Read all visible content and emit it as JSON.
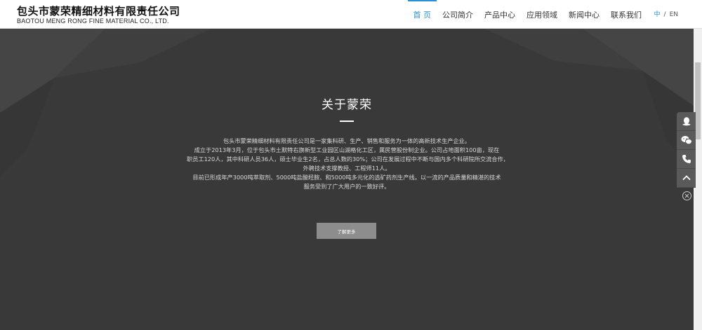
{
  "header": {
    "logo_cn": "包头市蒙荣精细材料有限责任公司",
    "logo_en": "BAOTOU MENG RONG FINE MATERIAL CO., LTD."
  },
  "nav": {
    "items": [
      {
        "label": "首 页",
        "active": true
      },
      {
        "label": "公司简介",
        "active": false
      },
      {
        "label": "产品中心",
        "active": false
      },
      {
        "label": "应用领域",
        "active": false
      },
      {
        "label": "新闻中心",
        "active": false
      },
      {
        "label": "联系我们",
        "active": false
      }
    ],
    "lang_cn": "中",
    "lang_sep": "/",
    "lang_en": "EN"
  },
  "about": {
    "title": "关于蒙荣",
    "lines": [
      "包头市蒙荣精细材料有限责任公司是一家集科研、生产、销售和服务为一体的高新技术生产企业。",
      "成立于2013年3月，位于包头市土默特右旗新型工业园区山湖格化工区，属民营股份制企业。公司占地面积100亩，现在",
      "职员工120人，其中科研人员36人，硕士毕业生2名，占总人数的30%；公司在发展过程中不断与国内多个科研院所交流合作，",
      "外聘技术支撑教授、工程师11人。",
      "目前已形成年产3000吨萃取剂、5000吨盐酸羟胺、和5000吨多元化的选矿药剂生产线。以一流的产品质量和精湛的技术",
      "服务受到了广大用户的一致好评。"
    ],
    "more_button": "了解更多"
  },
  "side_bar": {
    "icons": [
      "qq-icon",
      "wechat-icon",
      "phone-icon",
      "back-to-top-icon"
    ],
    "close_icon": "close-circle-icon"
  },
  "colors": {
    "accent": "#2a8fd6",
    "section_bg": "#3a393a",
    "button_bg": "#8d8d8d",
    "side_bar_bg": "#5a5a5a"
  }
}
